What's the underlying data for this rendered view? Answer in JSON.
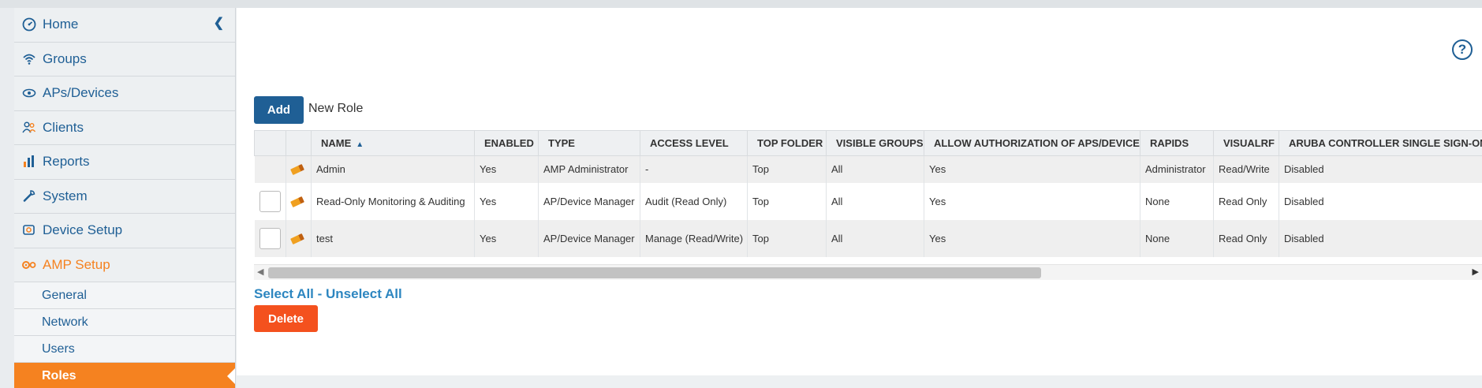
{
  "sidebar": {
    "items": [
      {
        "label": "Home",
        "icon": "dashboard-icon"
      },
      {
        "label": "Groups",
        "icon": "wifi-icon"
      },
      {
        "label": "APs/Devices",
        "icon": "eye-icon"
      },
      {
        "label": "Clients",
        "icon": "users-icon"
      },
      {
        "label": "Reports",
        "icon": "bar-chart-icon"
      },
      {
        "label": "System",
        "icon": "wrench-icon"
      },
      {
        "label": "Device Setup",
        "icon": "device-setup-icon"
      },
      {
        "label": "AMP Setup",
        "icon": "gears-icon"
      }
    ],
    "sub_items": [
      {
        "label": "General"
      },
      {
        "label": "Network"
      },
      {
        "label": "Users"
      },
      {
        "label": "Roles"
      }
    ],
    "active_item": "AMP Setup",
    "selected_sub": "Roles"
  },
  "toolbar": {
    "add_label": "Add",
    "add_text": "New Role"
  },
  "table": {
    "columns": [
      "NAME",
      "ENABLED",
      "TYPE",
      "ACCESS LEVEL",
      "TOP FOLDER",
      "VISIBLE GROUPS",
      "ALLOW AUTHORIZATION OF APS/DEVICES",
      "RAPIDS",
      "VISUALRF",
      "ARUBA CONTROLLER SINGLE SIGN-ON F"
    ],
    "rows": [
      {
        "name": "Admin",
        "enabled": "Yes",
        "type": "AMP Administrator",
        "access_level": "-",
        "top_folder": "Top",
        "visible_groups": "All",
        "allow_auth": "Yes",
        "rapids": "Administrator",
        "visualrf": "Read/Write",
        "sso": "Disabled"
      },
      {
        "name": "Read-Only Monitoring & Auditing",
        "enabled": "Yes",
        "type": "AP/Device Manager",
        "access_level": "Audit (Read Only)",
        "top_folder": "Top",
        "visible_groups": "All",
        "allow_auth": "Yes",
        "rapids": "None",
        "visualrf": "Read Only",
        "sso": "Disabled"
      },
      {
        "name": "test",
        "enabled": "Yes",
        "type": "AP/Device Manager",
        "access_level": "Manage (Read/Write)",
        "top_folder": "Top",
        "visible_groups": "All",
        "allow_auth": "Yes",
        "rapids": "None",
        "visualrf": "Read Only",
        "sso": "Disabled"
      }
    ]
  },
  "links": {
    "select_all": "Select All",
    "separator": " - ",
    "unselect_all": "Unselect All"
  },
  "actions": {
    "delete_label": "Delete"
  },
  "colors": {
    "nav_blue": "#1f5f95",
    "accent_orange": "#f58220",
    "delete_red": "#f4511e",
    "link_blue": "#2d86c0"
  }
}
